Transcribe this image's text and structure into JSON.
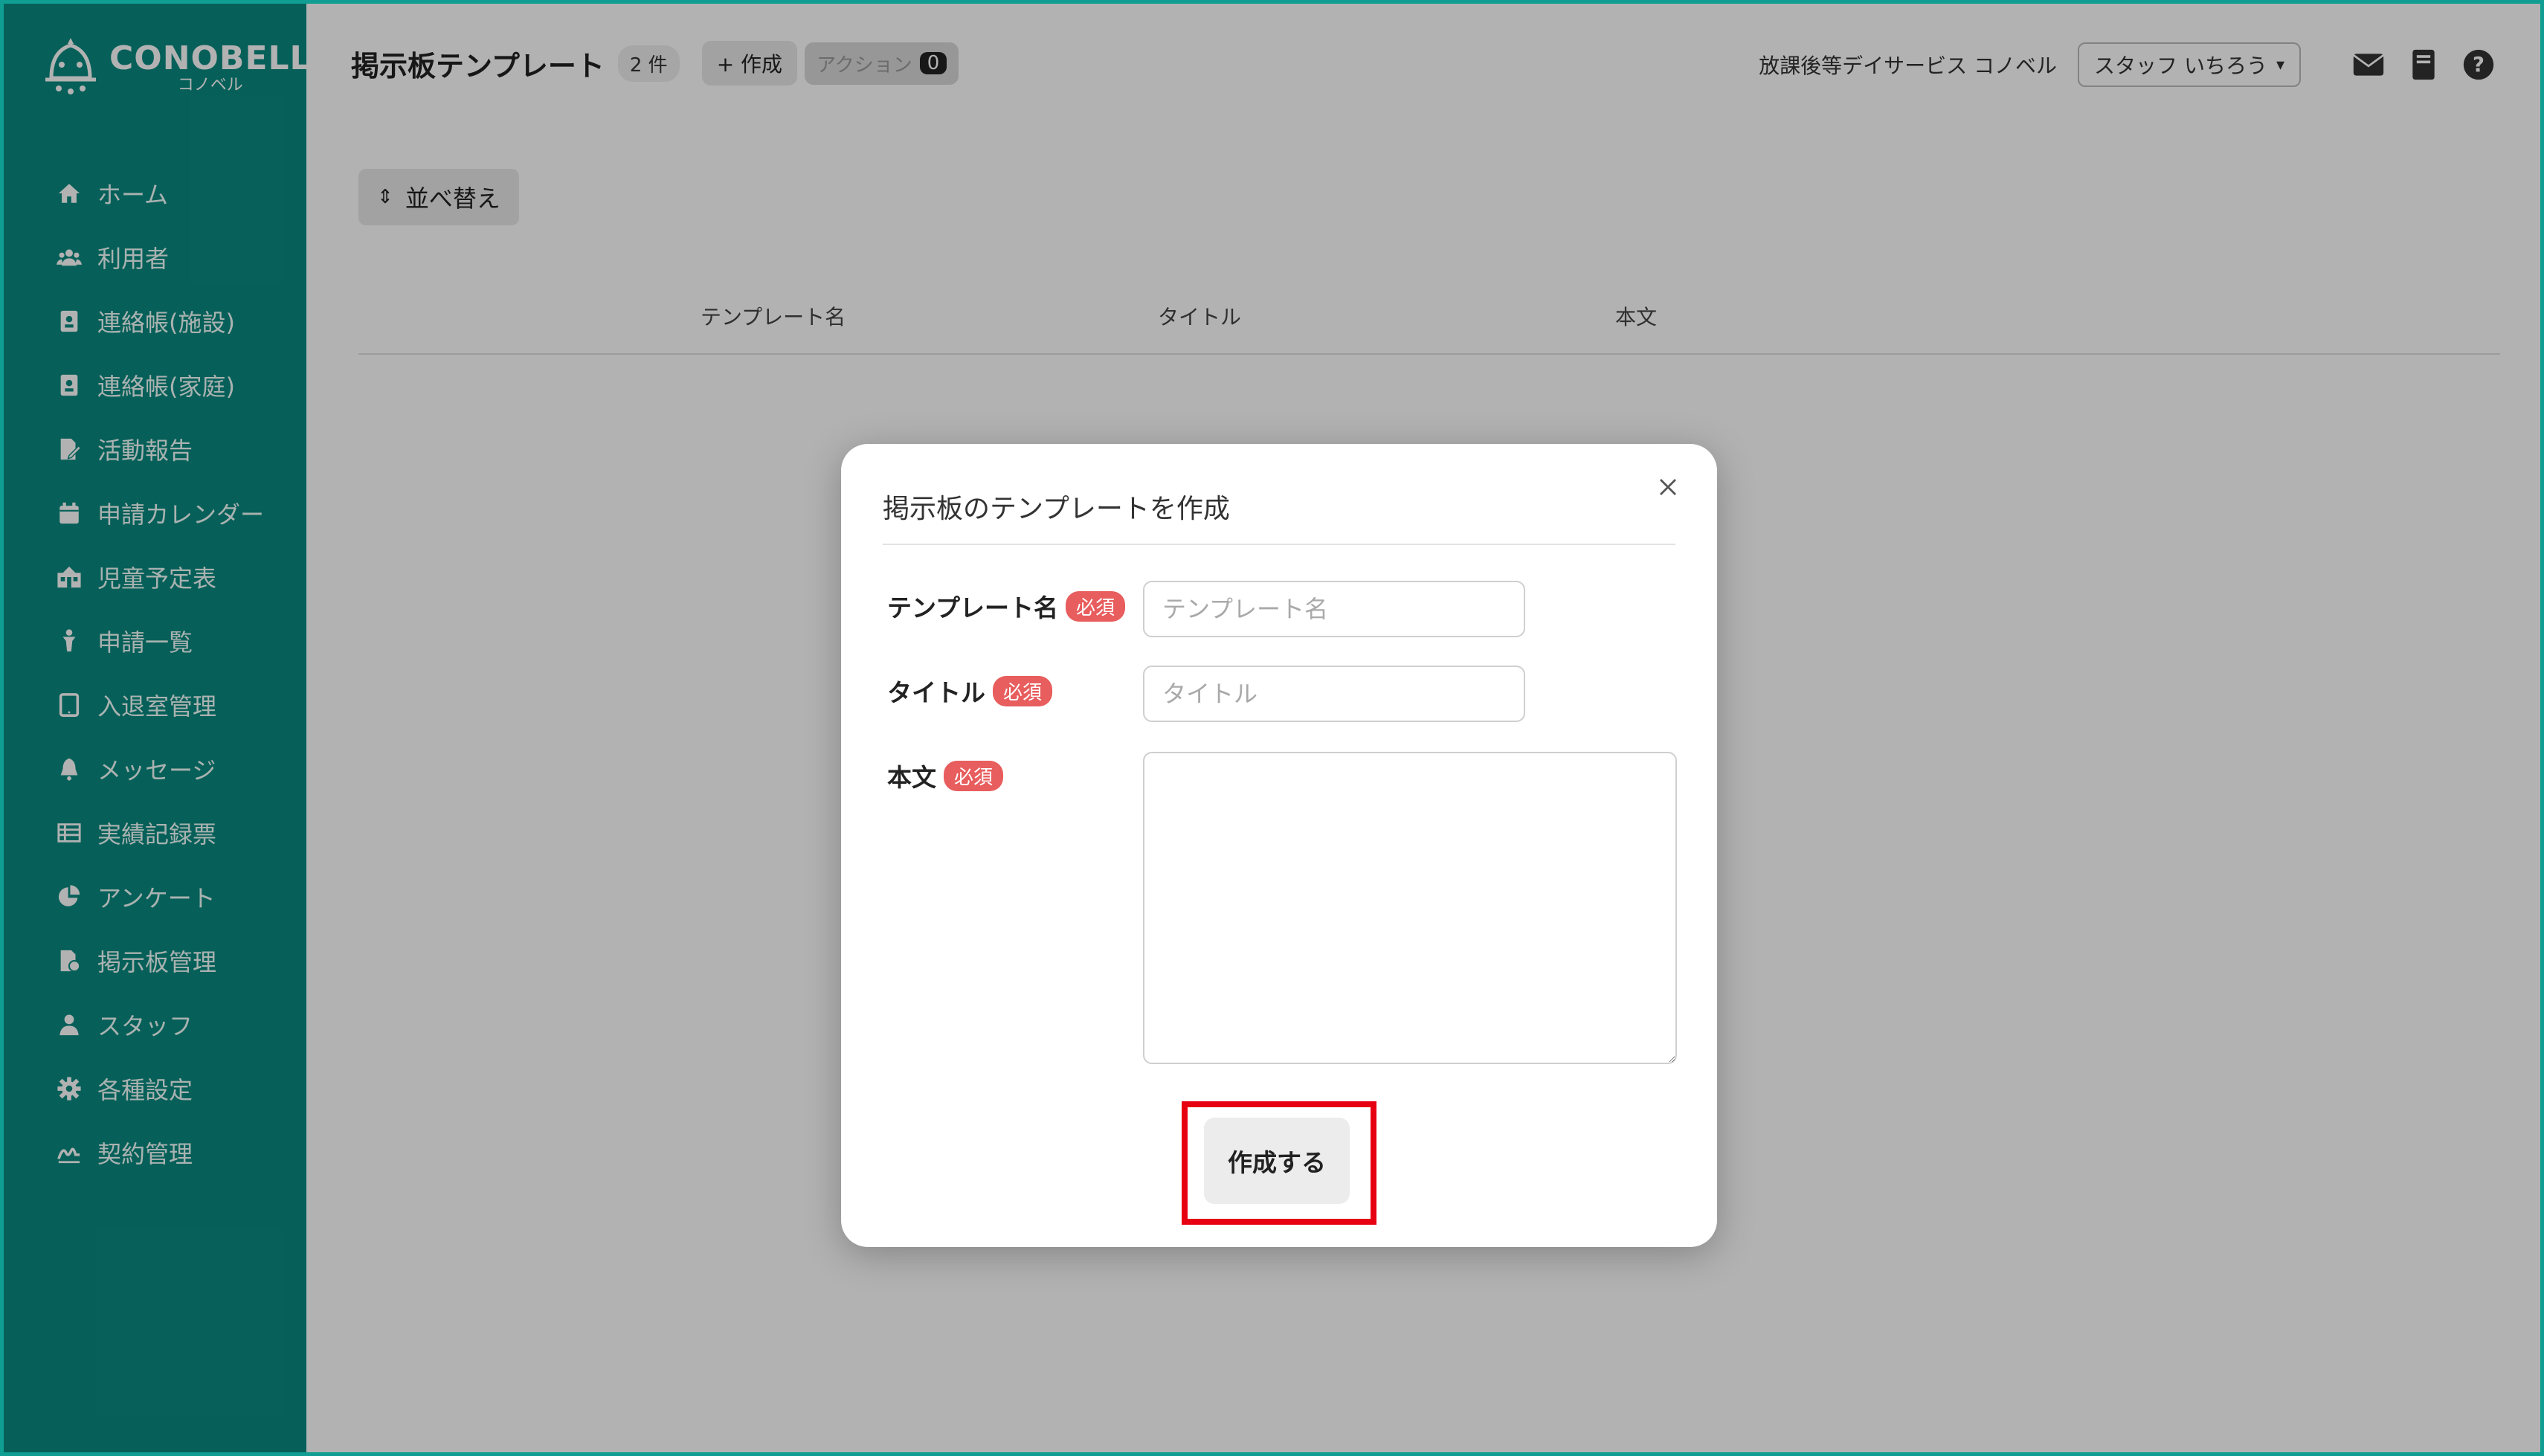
{
  "brand": {
    "name": "CONOBELL",
    "sub": "コノベル"
  },
  "sidebar": {
    "items": [
      {
        "label": "ホーム",
        "icon": "home-icon"
      },
      {
        "label": "利用者",
        "icon": "users-icon"
      },
      {
        "label": "連絡帳(施設)",
        "icon": "contact-book-icon"
      },
      {
        "label": "連絡帳(家庭)",
        "icon": "contact-book-icon"
      },
      {
        "label": "活動報告",
        "icon": "report-icon"
      },
      {
        "label": "申請カレンダー",
        "icon": "calendar-icon"
      },
      {
        "label": "児童予定表",
        "icon": "schedule-icon"
      },
      {
        "label": "申請一覧",
        "icon": "child-icon"
      },
      {
        "label": "入退室管理",
        "icon": "tablet-icon"
      },
      {
        "label": "メッセージ",
        "icon": "bell-icon"
      },
      {
        "label": "実績記録票",
        "icon": "table-icon"
      },
      {
        "label": "アンケート",
        "icon": "pie-chart-icon"
      },
      {
        "label": "掲示板管理",
        "icon": "board-icon"
      },
      {
        "label": "スタッフ",
        "icon": "staff-icon"
      },
      {
        "label": "各種設定",
        "icon": "gear-icon"
      },
      {
        "label": "契約管理",
        "icon": "signature-icon"
      }
    ]
  },
  "header": {
    "title": "掲示板テンプレート",
    "count": "2 件",
    "create_label": "+ 作成",
    "action_label": "アクション",
    "action_count": "0",
    "facility": "放課後等デイサービス コノベル",
    "staff": "スタッフ いちろう"
  },
  "toolbar": {
    "sort_label": "並べ替え"
  },
  "table": {
    "columns": [
      "テンプレート名",
      "タイトル",
      "本文"
    ]
  },
  "modal": {
    "title": "掲示板のテンプレートを作成",
    "required": "必須",
    "fields": {
      "template_name": {
        "label": "テンプレート名",
        "placeholder": "テンプレート名",
        "value": ""
      },
      "title": {
        "label": "タイトル",
        "placeholder": "タイトル",
        "value": ""
      },
      "body": {
        "label": "本文",
        "value": ""
      }
    },
    "submit_label": "作成する"
  },
  "colors": {
    "sidebar": "#0a8a80",
    "frame": "#0f9e91",
    "required": "#e85d5d",
    "highlight": "#e60012"
  }
}
